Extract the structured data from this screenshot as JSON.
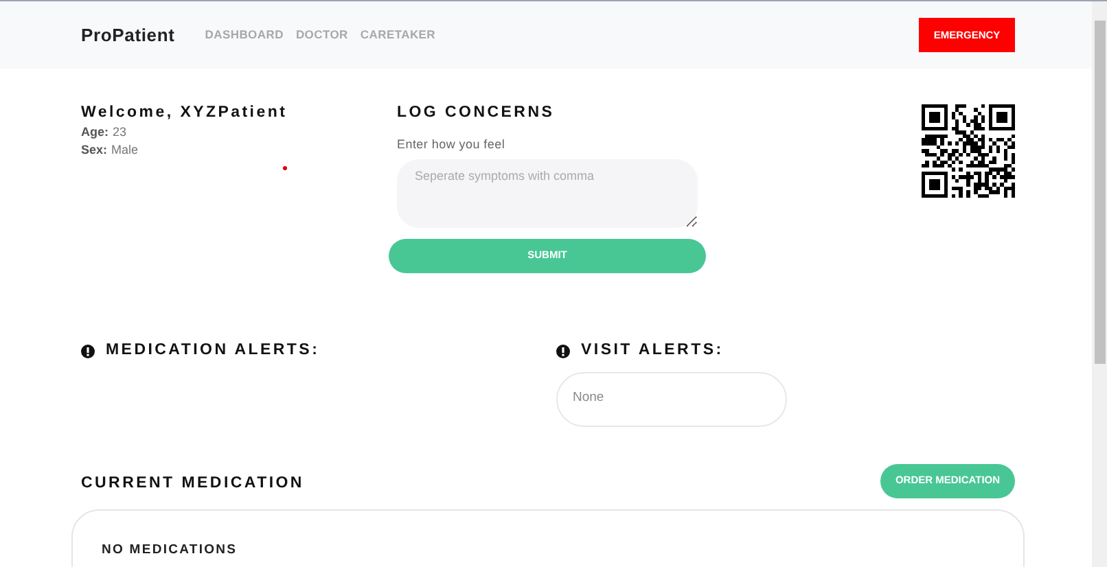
{
  "navbar": {
    "brand": "ProPatient",
    "links": [
      {
        "label": "DASHBOARD"
      },
      {
        "label": "DOCTOR"
      },
      {
        "label": "CARETAKER"
      }
    ],
    "emergency_button": "EMERGENCY"
  },
  "profile": {
    "greeting": "Welcome, XYZPatient",
    "fields": [
      {
        "label": "Age:",
        "value": "23"
      },
      {
        "label": "Sex:",
        "value": "Male"
      }
    ]
  },
  "log_concerns": {
    "title": "LOG CONCERNS",
    "field_label": "Enter how you feel",
    "placeholder": "Seperate symptoms with comma",
    "submit": "SUBMIT"
  },
  "medication_alerts": {
    "title": "MEDICATION ALERTS:"
  },
  "visit_alerts": {
    "title": "VISIT ALERTS:",
    "value": "None"
  },
  "current_medication": {
    "title": "CURRENT MEDICATION",
    "order_button": "ORDER MEDICATION",
    "empty_text": "NO MEDICATIONS"
  }
}
